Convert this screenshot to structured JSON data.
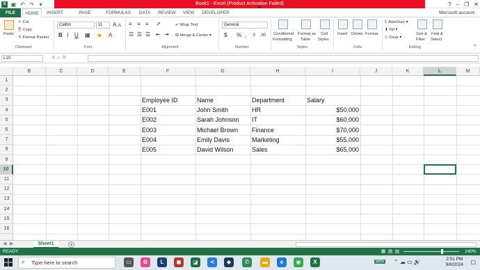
{
  "titlebar": {
    "title": "Book1 - Excel (Product Activation Failed)",
    "window_controls": [
      "?",
      "–",
      "❐",
      "✕"
    ],
    "accent": "#e81123"
  },
  "tabs": [
    "FILE",
    "HOME",
    "INSERT",
    "PAGE LAYOUT",
    "FORMULAS",
    "DATA",
    "REVIEW",
    "VIEW",
    "DEVELOPER"
  ],
  "account": "Microsoft account",
  "ribbon": {
    "clipboard": {
      "paste": "Paste",
      "cut": "Cut",
      "copy": "Copy",
      "format_painter": "Format Painter",
      "label": "Clipboard"
    },
    "font": {
      "name": "Calibri",
      "size": "11",
      "bold": "B",
      "italic": "I",
      "underline": "U",
      "label": "Font"
    },
    "alignment": {
      "wrap_text": "Wrap Text",
      "merge_center": "Merge & Center",
      "label": "Alignment"
    },
    "number": {
      "format": "General",
      "currency": "$",
      "percent": "%",
      "comma": ",",
      "label": "Number"
    },
    "styles": {
      "conditional": "Conditional",
      "conditional2": "Formatting",
      "format_as": "Format as",
      "table": "Table",
      "cell": "Cell",
      "styles": "Styles",
      "label": "Styles"
    },
    "cells": {
      "insert": "Insert",
      "delete": "Delete",
      "format": "Format",
      "label": "Cells"
    },
    "editing": {
      "autosum": "AutoSum",
      "fill": "Fill",
      "clear": "Clear",
      "sort": "Sort &",
      "filter": "Filter",
      "find": "Find &",
      "select": "Select",
      "label": "Editing"
    }
  },
  "formula_bar": {
    "name_box": "L10",
    "fx": "fx",
    "value": ""
  },
  "columns": [
    "B",
    "C",
    "D",
    "E",
    "F",
    "G",
    "H",
    "I",
    "J",
    "K",
    "L",
    "M"
  ],
  "rows": [
    "1",
    "2",
    "3",
    "4",
    "5",
    "6",
    "7",
    "8",
    "9",
    "10",
    "11",
    "12",
    "13",
    "14",
    "15",
    "16"
  ],
  "selected_cell": {
    "column": "L",
    "row": "10"
  },
  "table": {
    "headers": [
      "Employee ID",
      "Name",
      "Department",
      "Salary"
    ],
    "rows": [
      [
        "E001",
        "John Smith",
        "HR",
        "$50,000"
      ],
      [
        "E002",
        "Sarah Johnson",
        "IT",
        "$60,000"
      ],
      [
        "E003",
        "Michael Brown",
        "Finance",
        "$70,000"
      ],
      [
        "E004",
        "Emily Davis",
        "Marketing",
        "$55,000"
      ],
      [
        "E005",
        "David Wilson",
        "Sales",
        "$65,000"
      ]
    ]
  },
  "sheets": [
    "Sheet1"
  ],
  "status": {
    "ready": "READY",
    "zoom": "140%"
  },
  "taskbar": {
    "search_placeholder": "Type here to search",
    "time": "2:51 PM",
    "date": "9/8/2024",
    "battery": "58%"
  },
  "colors": {
    "excel_green": "#217346",
    "title_red": "#e81123"
  }
}
